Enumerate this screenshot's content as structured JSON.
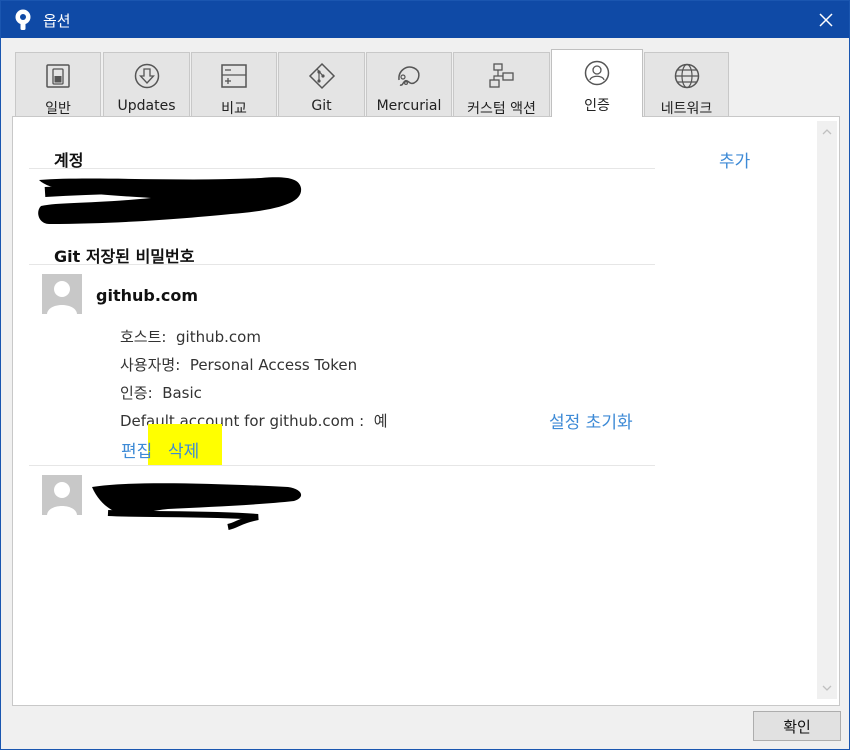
{
  "window": {
    "title": "옵션"
  },
  "tabs": [
    {
      "label": "일반",
      "icon": "general-icon"
    },
    {
      "label": "Updates",
      "icon": "download-icon"
    },
    {
      "label": "비교",
      "icon": "diff-icon"
    },
    {
      "label": "Git",
      "icon": "git-icon"
    },
    {
      "label": "Mercurial",
      "icon": "mercurial-icon"
    },
    {
      "label": "커스텀 액션",
      "icon": "custom-action-icon"
    },
    {
      "label": "인증",
      "icon": "user-icon"
    },
    {
      "label": "네트워크",
      "icon": "globe-icon"
    }
  ],
  "active_tab": "인증",
  "accounts": {
    "heading": "계정",
    "add_label": "추가"
  },
  "git_passwords": {
    "heading": "Git 저장된 비밀번호",
    "entry": {
      "name": "github.com",
      "host_label": "호스트:",
      "host_value": "github.com",
      "username_label": "사용자명:",
      "username_value": "Personal Access Token",
      "auth_label": "인증:",
      "auth_value": "Basic",
      "default_label": "Default account for github.com :",
      "default_value": "예",
      "reset_label": "설정 초기화",
      "edit_label": "편집",
      "delete_label": "삭제"
    }
  },
  "footer": {
    "ok_label": "확인"
  },
  "colors": {
    "titlebar": "#0f4aa6",
    "link": "#3d8ad6",
    "highlight": "#ffff00"
  }
}
